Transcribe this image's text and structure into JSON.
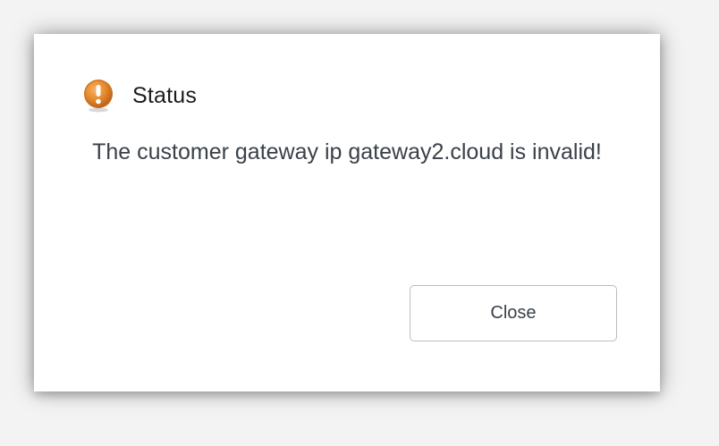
{
  "dialog": {
    "title": "Status",
    "icon": "warning-exclamation-icon",
    "message": "The customer gateway ip gateway2.cloud is invalid!",
    "close_label": "Close"
  },
  "colors": {
    "icon_orange": "#e07a1f",
    "button_border": "#b9bec4",
    "message_text": "#3a4149"
  }
}
